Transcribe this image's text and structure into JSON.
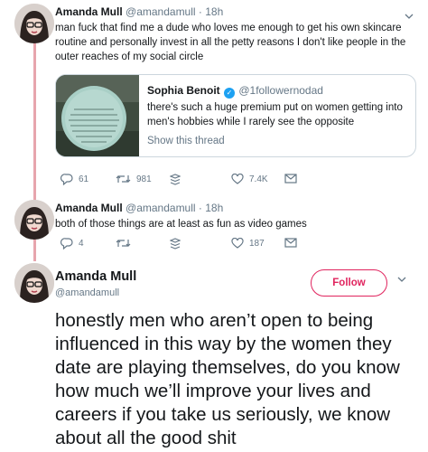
{
  "colors": {
    "accent": "#e0245e",
    "verified": "#1da1f2",
    "thread_line": "#e7a5ad",
    "muted": "#657786"
  },
  "tweet1": {
    "name": "Amanda Mull",
    "handle_time": "@amandamull · 18h",
    "text": "man fuck that find me a dude who loves me enough to get his own skincare routine and personally invest in all the petty reasons I don't like people in the outer reaches of my social circle",
    "quote": {
      "name": "Sophia Benoit",
      "handle": "@1followernodad",
      "text": "there's such a huge premium put on women getting into men's hobbies while I rarely see the opposite",
      "show_thread": "Show this thread",
      "image_text": "That's What I Like"
    },
    "actions": {
      "replies": "61",
      "retweets": "981",
      "likes": "7.4K"
    }
  },
  "tweet2": {
    "name": "Amanda Mull",
    "handle_time": "@amandamull · 18h",
    "text": "both of those things are at least as fun as video games",
    "actions": {
      "replies": "4",
      "retweets": "",
      "likes": "187"
    }
  },
  "tweet3": {
    "name": "Amanda Mull",
    "handle": "@amandamull",
    "follow_label": "Follow",
    "text": "honestly men who aren’t open to being influenced in this way by the women they date are playing themselves, do you know how much we’ll improve your lives and careers if you take us seriously, we know about all the good shit"
  },
  "icons": [
    "reply-icon",
    "retweet-icon",
    "stack-icon",
    "heart-icon",
    "message-icon",
    "chevron-down-icon",
    "verified-icon"
  ]
}
